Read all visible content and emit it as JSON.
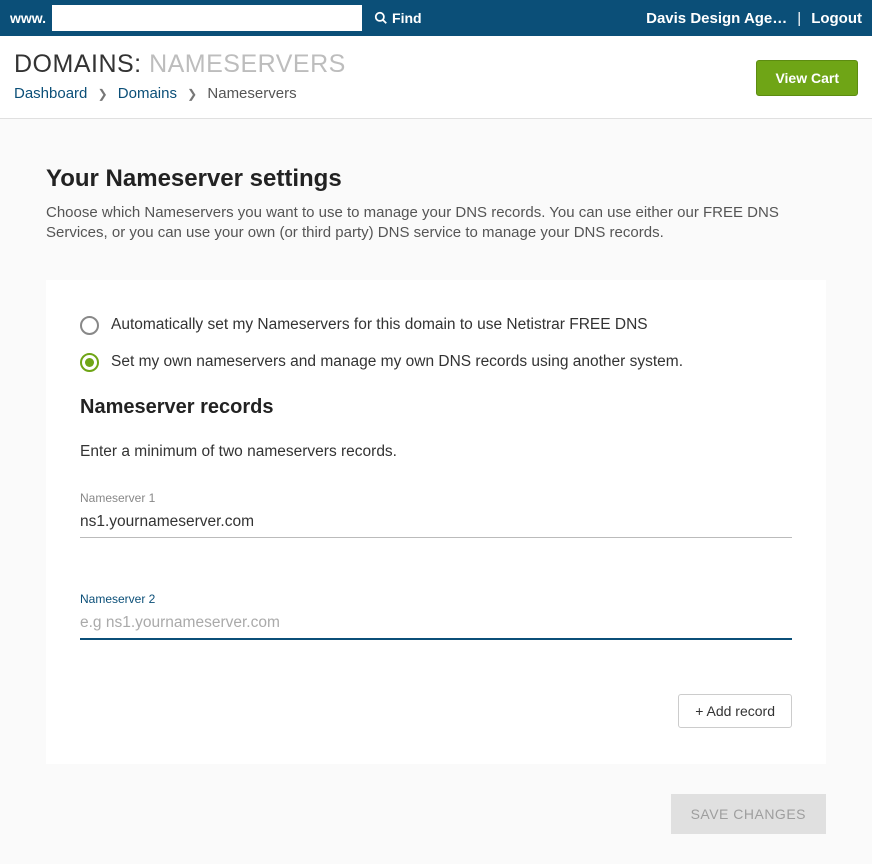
{
  "topbar": {
    "prefix": "www.",
    "search_value": "",
    "find_label": "Find",
    "account_name": "Davis Design Age…",
    "separator": "|",
    "logout_label": "Logout"
  },
  "header": {
    "title_main": "DOMAINS:",
    "title_sub": "NAMESERVERS",
    "breadcrumb": {
      "dashboard": "Dashboard",
      "domains": "Domains",
      "current": "Nameservers"
    },
    "view_cart_label": "View Cart"
  },
  "main": {
    "section_title": "Your Nameserver settings",
    "section_desc": "Choose which Nameservers you want to use to manage your DNS records. You can use either our FREE DNS Services, or you can use your own (or third party) DNS service to manage your DNS records.",
    "radios": {
      "auto": "Automatically set my Nameservers for this domain to use Netistrar FREE DNS",
      "own": "Set my own nameservers and manage my own DNS records using another system."
    },
    "records_title": "Nameserver records",
    "records_hint": "Enter a minimum of two nameservers records.",
    "fields": {
      "ns1": {
        "label": "Nameserver 1",
        "value": "ns1.yournameserver.com",
        "placeholder": ""
      },
      "ns2": {
        "label": "Nameserver 2",
        "value": "",
        "placeholder": "e.g ns1.yournameserver.com"
      }
    },
    "add_record_label": "+ Add record",
    "save_label": "SAVE CHANGES"
  }
}
